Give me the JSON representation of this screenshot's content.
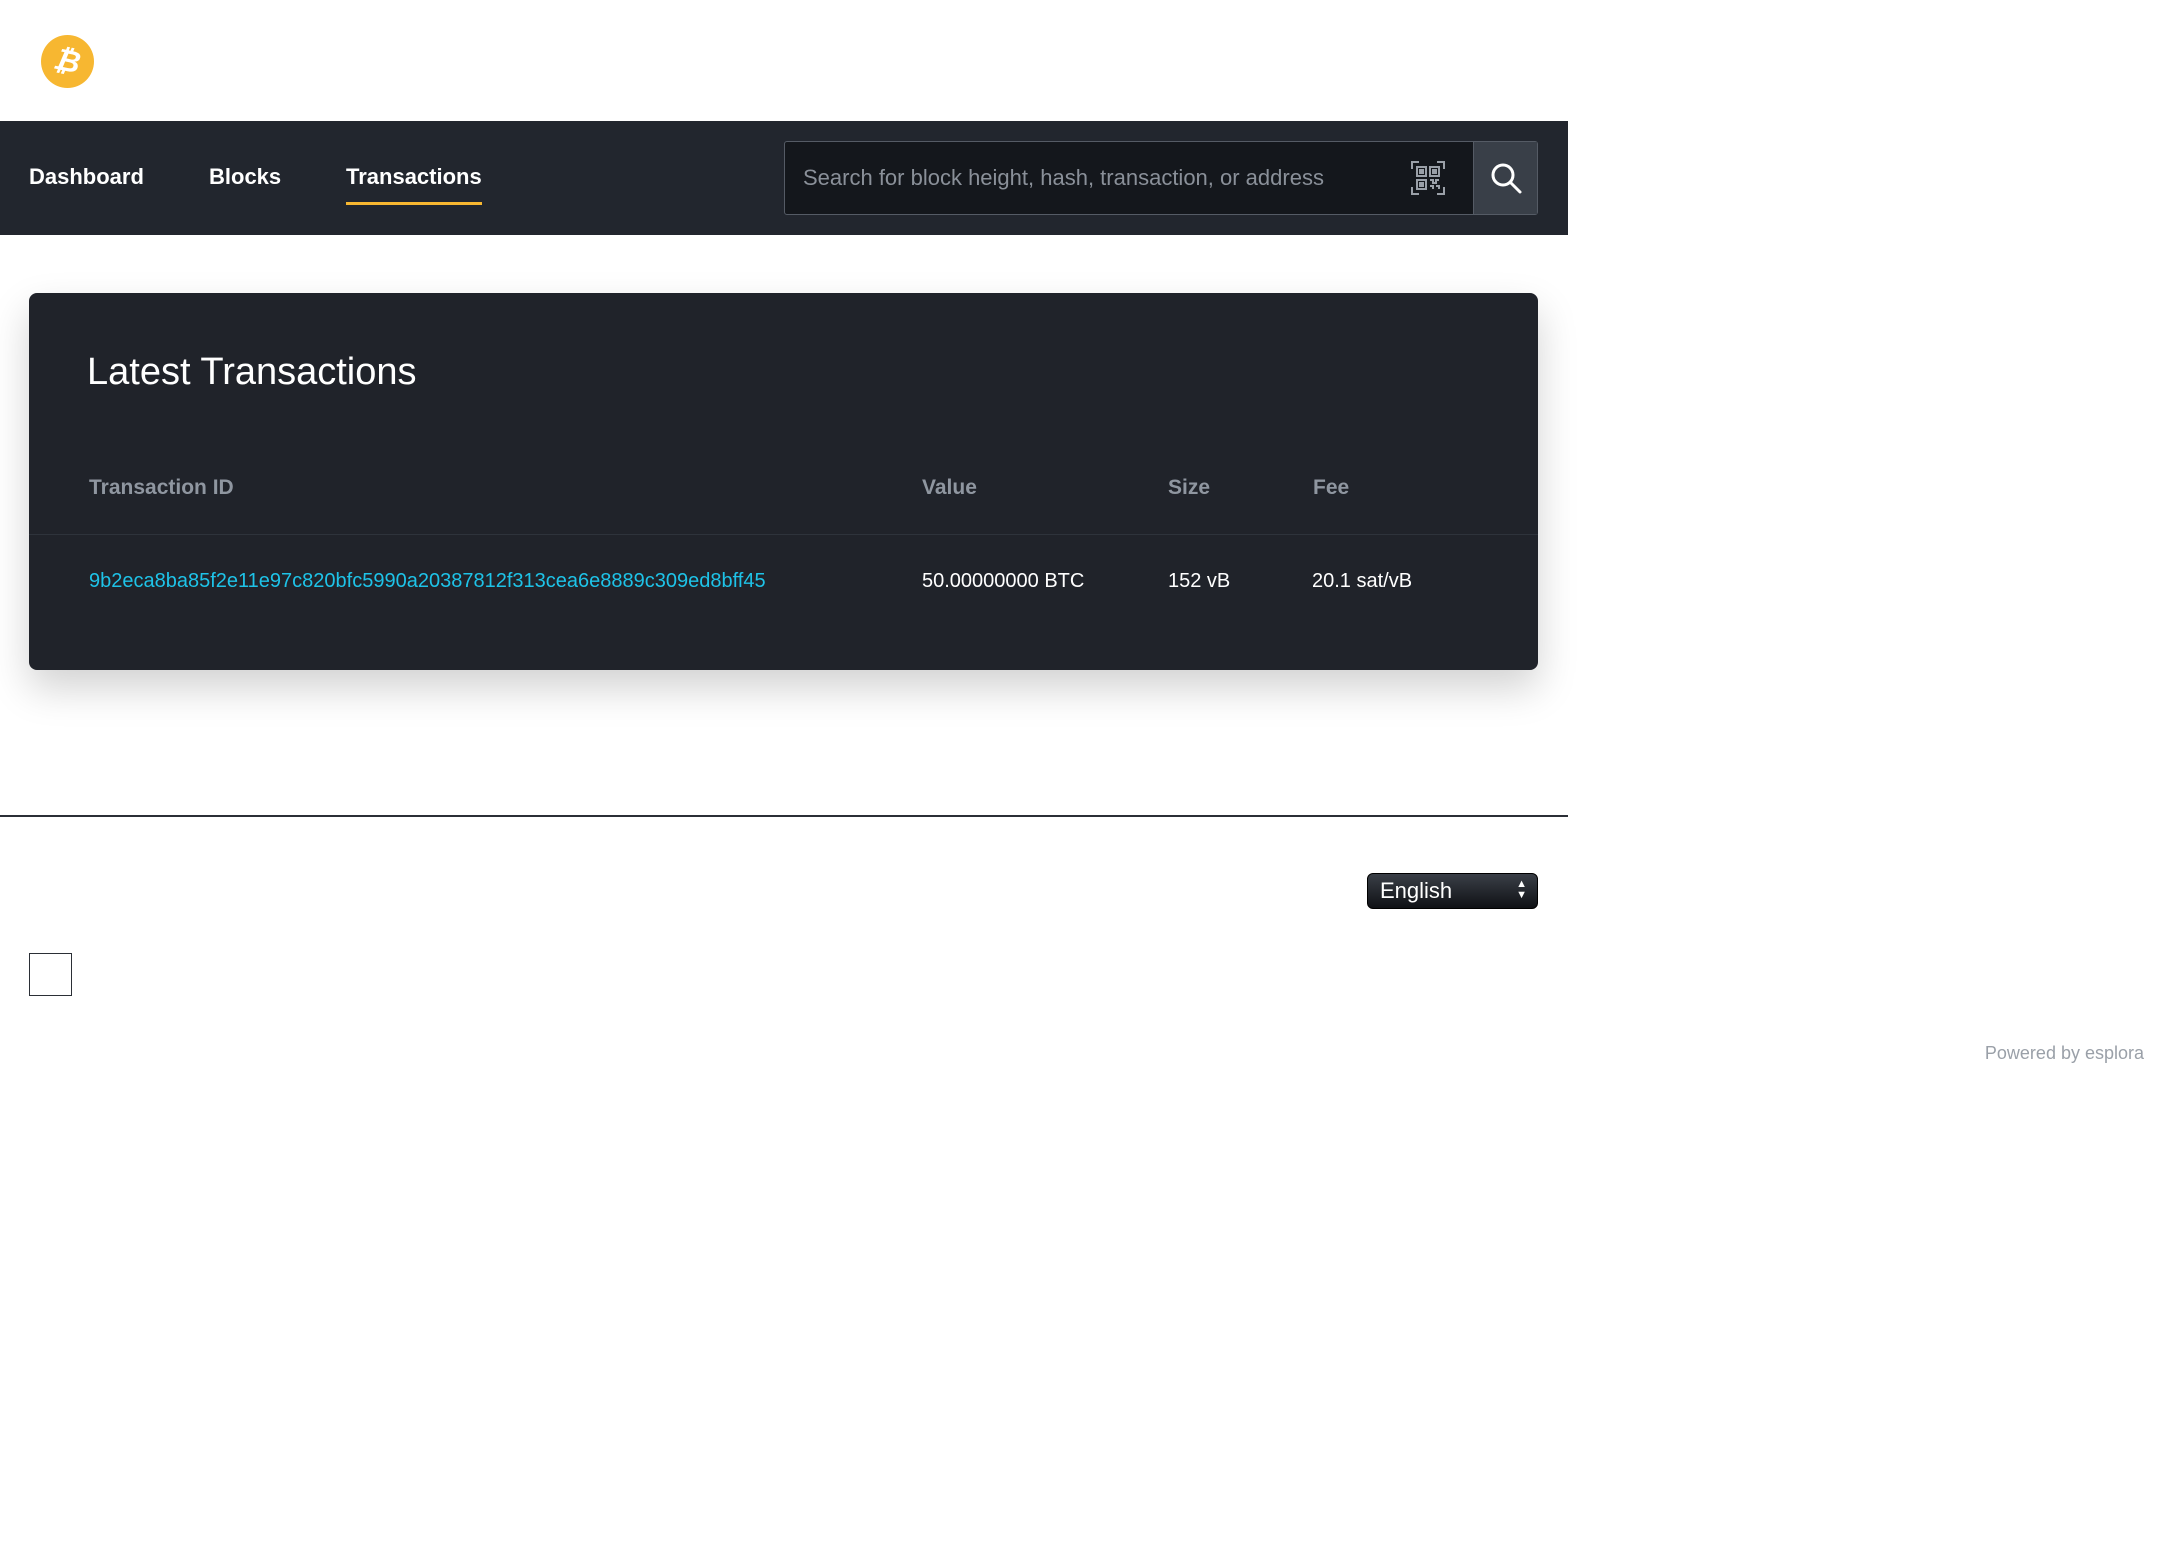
{
  "header": {
    "logo_icon": "bitcoin-logo-icon",
    "logo_glyph": "₿",
    "accent_color": "#f7b731"
  },
  "nav": {
    "items": [
      {
        "label": "Dashboard",
        "active": false
      },
      {
        "label": "Blocks",
        "active": false
      },
      {
        "label": "Transactions",
        "active": true
      }
    ]
  },
  "search": {
    "placeholder": "Search for block height, hash, transaction, or address",
    "value": "",
    "qr_icon": "qr-code-icon",
    "search_icon": "magnifier-icon"
  },
  "main": {
    "title": "Latest Transactions",
    "columns": [
      "Transaction ID",
      "Value",
      "Size",
      "Fee"
    ],
    "rows": [
      {
        "txid": "9b2eca8ba85f2e11e97c820bfc5990a20387812f313cea6e8889c309ed8bff45",
        "value": "50.00000000 BTC",
        "size": "152 vB",
        "fee": "20.1 sat/vB"
      }
    ],
    "link_color": "#1ec3e8"
  },
  "footer": {
    "language": "English",
    "powered_by": "Powered by esplora"
  }
}
